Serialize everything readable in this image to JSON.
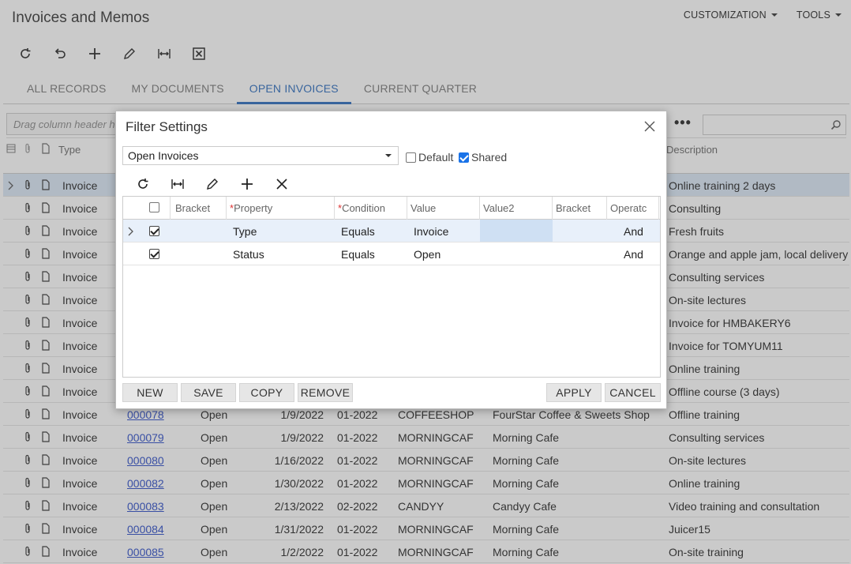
{
  "page": {
    "title": "Invoices and Memos",
    "menu": [
      "CUSTOMIZATION",
      "TOOLS"
    ],
    "toolbar_icons": [
      "refresh-icon",
      "undo-icon",
      "add-icon",
      "edit-icon",
      "fit-columns-icon",
      "export-excel-icon"
    ]
  },
  "tabs": [
    {
      "label": "ALL RECORDS",
      "active": false
    },
    {
      "label": "MY DOCUMENTS",
      "active": false
    },
    {
      "label": "OPEN INVOICES",
      "active": true
    },
    {
      "label": "CURRENT QUARTER",
      "active": false
    }
  ],
  "groupbar": {
    "placeholder": "Drag column header h"
  },
  "grid": {
    "headers": {
      "type": "Type",
      "description": "Description"
    },
    "rows": [
      {
        "type": "Invoice",
        "description": "Online training 2 days",
        "selected": true
      },
      {
        "type": "Invoice",
        "description": "Consulting"
      },
      {
        "type": "Invoice",
        "description": "Fresh fruits"
      },
      {
        "type": "Invoice",
        "description": "Orange and apple jam, local delivery"
      },
      {
        "type": "Invoice",
        "description": "Consulting services"
      },
      {
        "type": "Invoice",
        "description": "On-site lectures"
      },
      {
        "type": "Invoice",
        "description": "Invoice for HMBAKERY6"
      },
      {
        "type": "Invoice",
        "description": "Invoice for TOMYUM11"
      },
      {
        "type": "Invoice",
        "description": "Online training"
      },
      {
        "type": "Invoice",
        "description": "Offline course (3 days)"
      },
      {
        "type": "Invoice",
        "ref": "000078",
        "status": "Open",
        "date": "1/9/2022",
        "period": "01-2022",
        "customer": "COFFEESHOP",
        "name": "FourStar Coffee & Sweets Shop",
        "description": "Offline training"
      },
      {
        "type": "Invoice",
        "ref": "000079",
        "status": "Open",
        "date": "1/9/2022",
        "period": "01-2022",
        "customer": "MORNINGCAF",
        "name": "Morning Cafe",
        "description": "Consulting services"
      },
      {
        "type": "Invoice",
        "ref": "000080",
        "status": "Open",
        "date": "1/16/2022",
        "period": "01-2022",
        "customer": "MORNINGCAF",
        "name": "Morning Cafe",
        "description": "On-site lectures"
      },
      {
        "type": "Invoice",
        "ref": "000082",
        "status": "Open",
        "date": "1/30/2022",
        "period": "01-2022",
        "customer": "MORNINGCAF",
        "name": "Morning Cafe",
        "description": "Online training"
      },
      {
        "type": "Invoice",
        "ref": "000083",
        "status": "Open",
        "date": "2/13/2022",
        "period": "02-2022",
        "customer": "CANDYY",
        "name": "Candyy Cafe",
        "description": "Video training and consultation"
      },
      {
        "type": "Invoice",
        "ref": "000084",
        "status": "Open",
        "date": "1/31/2022",
        "period": "01-2022",
        "customer": "MORNINGCAF",
        "name": "Morning Cafe",
        "description": "Juicer15"
      },
      {
        "type": "Invoice",
        "ref": "000085",
        "status": "Open",
        "date": "1/2/2022",
        "period": "01-2022",
        "customer": "MORNINGCAF",
        "name": "Morning Cafe",
        "description": "On-site training"
      }
    ]
  },
  "dialog": {
    "title": "Filter Settings",
    "filter_name": "Open Invoices",
    "default_label": "Default",
    "default_checked": false,
    "shared_label": "Shared",
    "shared_checked": true,
    "columns": {
      "bracket": "Bracket",
      "property": "Property",
      "condition": "Condition",
      "value": "Value",
      "value2": "Value2",
      "bracket2": "Bracket",
      "operator": "Operatc"
    },
    "rows": [
      {
        "active": true,
        "property": "Type",
        "condition": "Equals",
        "value": "Invoice",
        "operator": "And"
      },
      {
        "active": true,
        "property": "Status",
        "condition": "Equals",
        "value": "Open",
        "operator": "And"
      }
    ],
    "buttons": {
      "new": "NEW",
      "save": "SAVE",
      "copy": "COPY",
      "remove": "REMOVE",
      "apply": "APPLY",
      "cancel": "CANCEL"
    }
  }
}
